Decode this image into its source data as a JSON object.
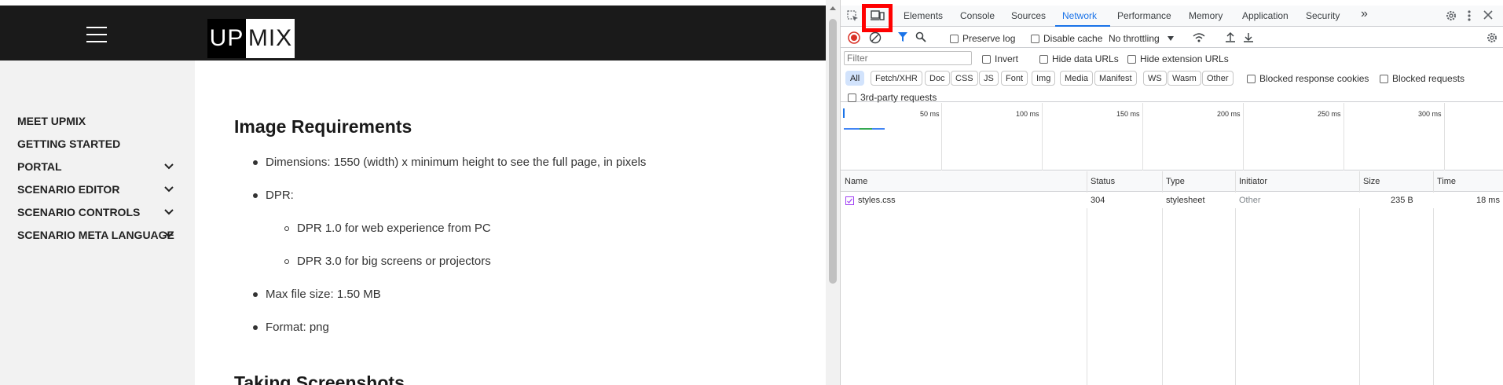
{
  "page": {
    "logo_left": "UP",
    "logo_right": "MIX",
    "nav": [
      {
        "label": "MEET UPMIX",
        "chevron": false
      },
      {
        "label": "GETTING STARTED",
        "chevron": false
      },
      {
        "label": "PORTAL",
        "chevron": true
      },
      {
        "label": "SCENARIO EDITOR",
        "chevron": true
      },
      {
        "label": "SCENARIO CONTROLS",
        "chevron": true
      },
      {
        "label": "SCENARIO META LANGUAGE",
        "chevron": true
      }
    ],
    "heading1": "Image Requirements",
    "bullets": [
      "Dimensions: 1550 (width) x minimum height to see the full page, in pixels",
      "DPR:",
      "Max file size: 1.50 MB",
      "Format: png"
    ],
    "sub_bullets": [
      "DPR 1.0 for web experience from PC",
      "DPR 3.0 for big screens or projectors"
    ],
    "heading2": "Taking Screenshots"
  },
  "devtools": {
    "tabs": [
      "Elements",
      "Console",
      "Sources",
      "Network",
      "Performance",
      "Memory",
      "Application",
      "Security"
    ],
    "active_tab": "Network",
    "more_tabs": "»",
    "toolbar": {
      "preserve_log": "Preserve log",
      "disable_cache": "Disable cache",
      "throttling": "No throttling"
    },
    "filter": {
      "placeholder": "Filter",
      "invert": "Invert",
      "hide_data_urls": "Hide data URLs",
      "hide_extension_urls": "Hide extension URLs",
      "types": [
        "All",
        "Fetch/XHR",
        "Doc",
        "CSS",
        "JS",
        "Font",
        "Img",
        "Media",
        "Manifest",
        "WS",
        "Wasm",
        "Other"
      ],
      "active_type": "All",
      "blocked_response_cookies": "Blocked response cookies",
      "blocked_requests": "Blocked requests",
      "third_party": "3rd-party requests"
    },
    "timeline_ticks": [
      "50 ms",
      "100 ms",
      "150 ms",
      "200 ms",
      "250 ms",
      "300 ms"
    ],
    "columns": [
      "Name",
      "Status",
      "Type",
      "Initiator",
      "Size",
      "Time"
    ],
    "rows": [
      {
        "name": "styles.css",
        "status": "304",
        "type": "stylesheet",
        "initiator": "Other",
        "size": "235 B",
        "time": "18 ms"
      }
    ],
    "colors": {
      "accent": "#1a73e8",
      "highlight": "#ff0000",
      "record": "#d93025"
    }
  }
}
